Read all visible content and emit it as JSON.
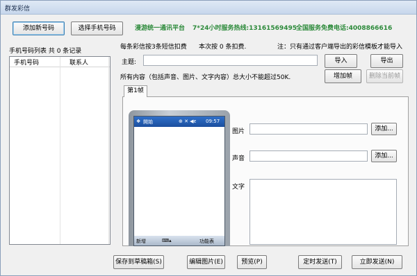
{
  "window": {
    "title": "群发彩信"
  },
  "toolbar": {
    "add_new_number": "添加新号码",
    "select_phone_number": "选择手机号码"
  },
  "banner": {
    "platform": "漫游统一通讯平台",
    "hotline": "7*24小时服务热线:13161569495",
    "freephone": "全国服务免费电话:4008866616"
  },
  "left_panel": {
    "list_title": "手机号码列表 共 0 条记录",
    "columns": [
      "手机号码",
      "联系人"
    ]
  },
  "info": {
    "per_message": "每条彩信按3条短信扣费",
    "this_time_prefix": "本次按 ",
    "this_time_count": "0",
    "this_time_suffix": " 条扣费.",
    "note": "注：只有通过客户端导出的彩信模板才能导入",
    "size_note": "所有内容（包括声音、图片、文字内容）总大小不能超过50K."
  },
  "subject": {
    "label": "主题:",
    "value": ""
  },
  "buttons": {
    "import": "导入",
    "export": "导出",
    "add_frame": "增加帧",
    "delete_frame": "删除当前帧",
    "add_image": "添加...",
    "add_sound": "添加...",
    "save_draft": "保存到草稿箱(S)",
    "edit_image": "编辑图片(E)",
    "preview": "预览(P)",
    "scheduled_send": "定时发送(T)",
    "send_now": "立即发送(N)"
  },
  "tab": {
    "label": "第1帧"
  },
  "fields": {
    "image_label": "图片",
    "sound_label": "声音",
    "text_label": "文字",
    "image_value": "",
    "sound_value": "",
    "text_value": ""
  },
  "phone_preview": {
    "status_left": "開始",
    "status_time": "09:57",
    "bottom_left": "新增",
    "bottom_right": "功能表"
  }
}
